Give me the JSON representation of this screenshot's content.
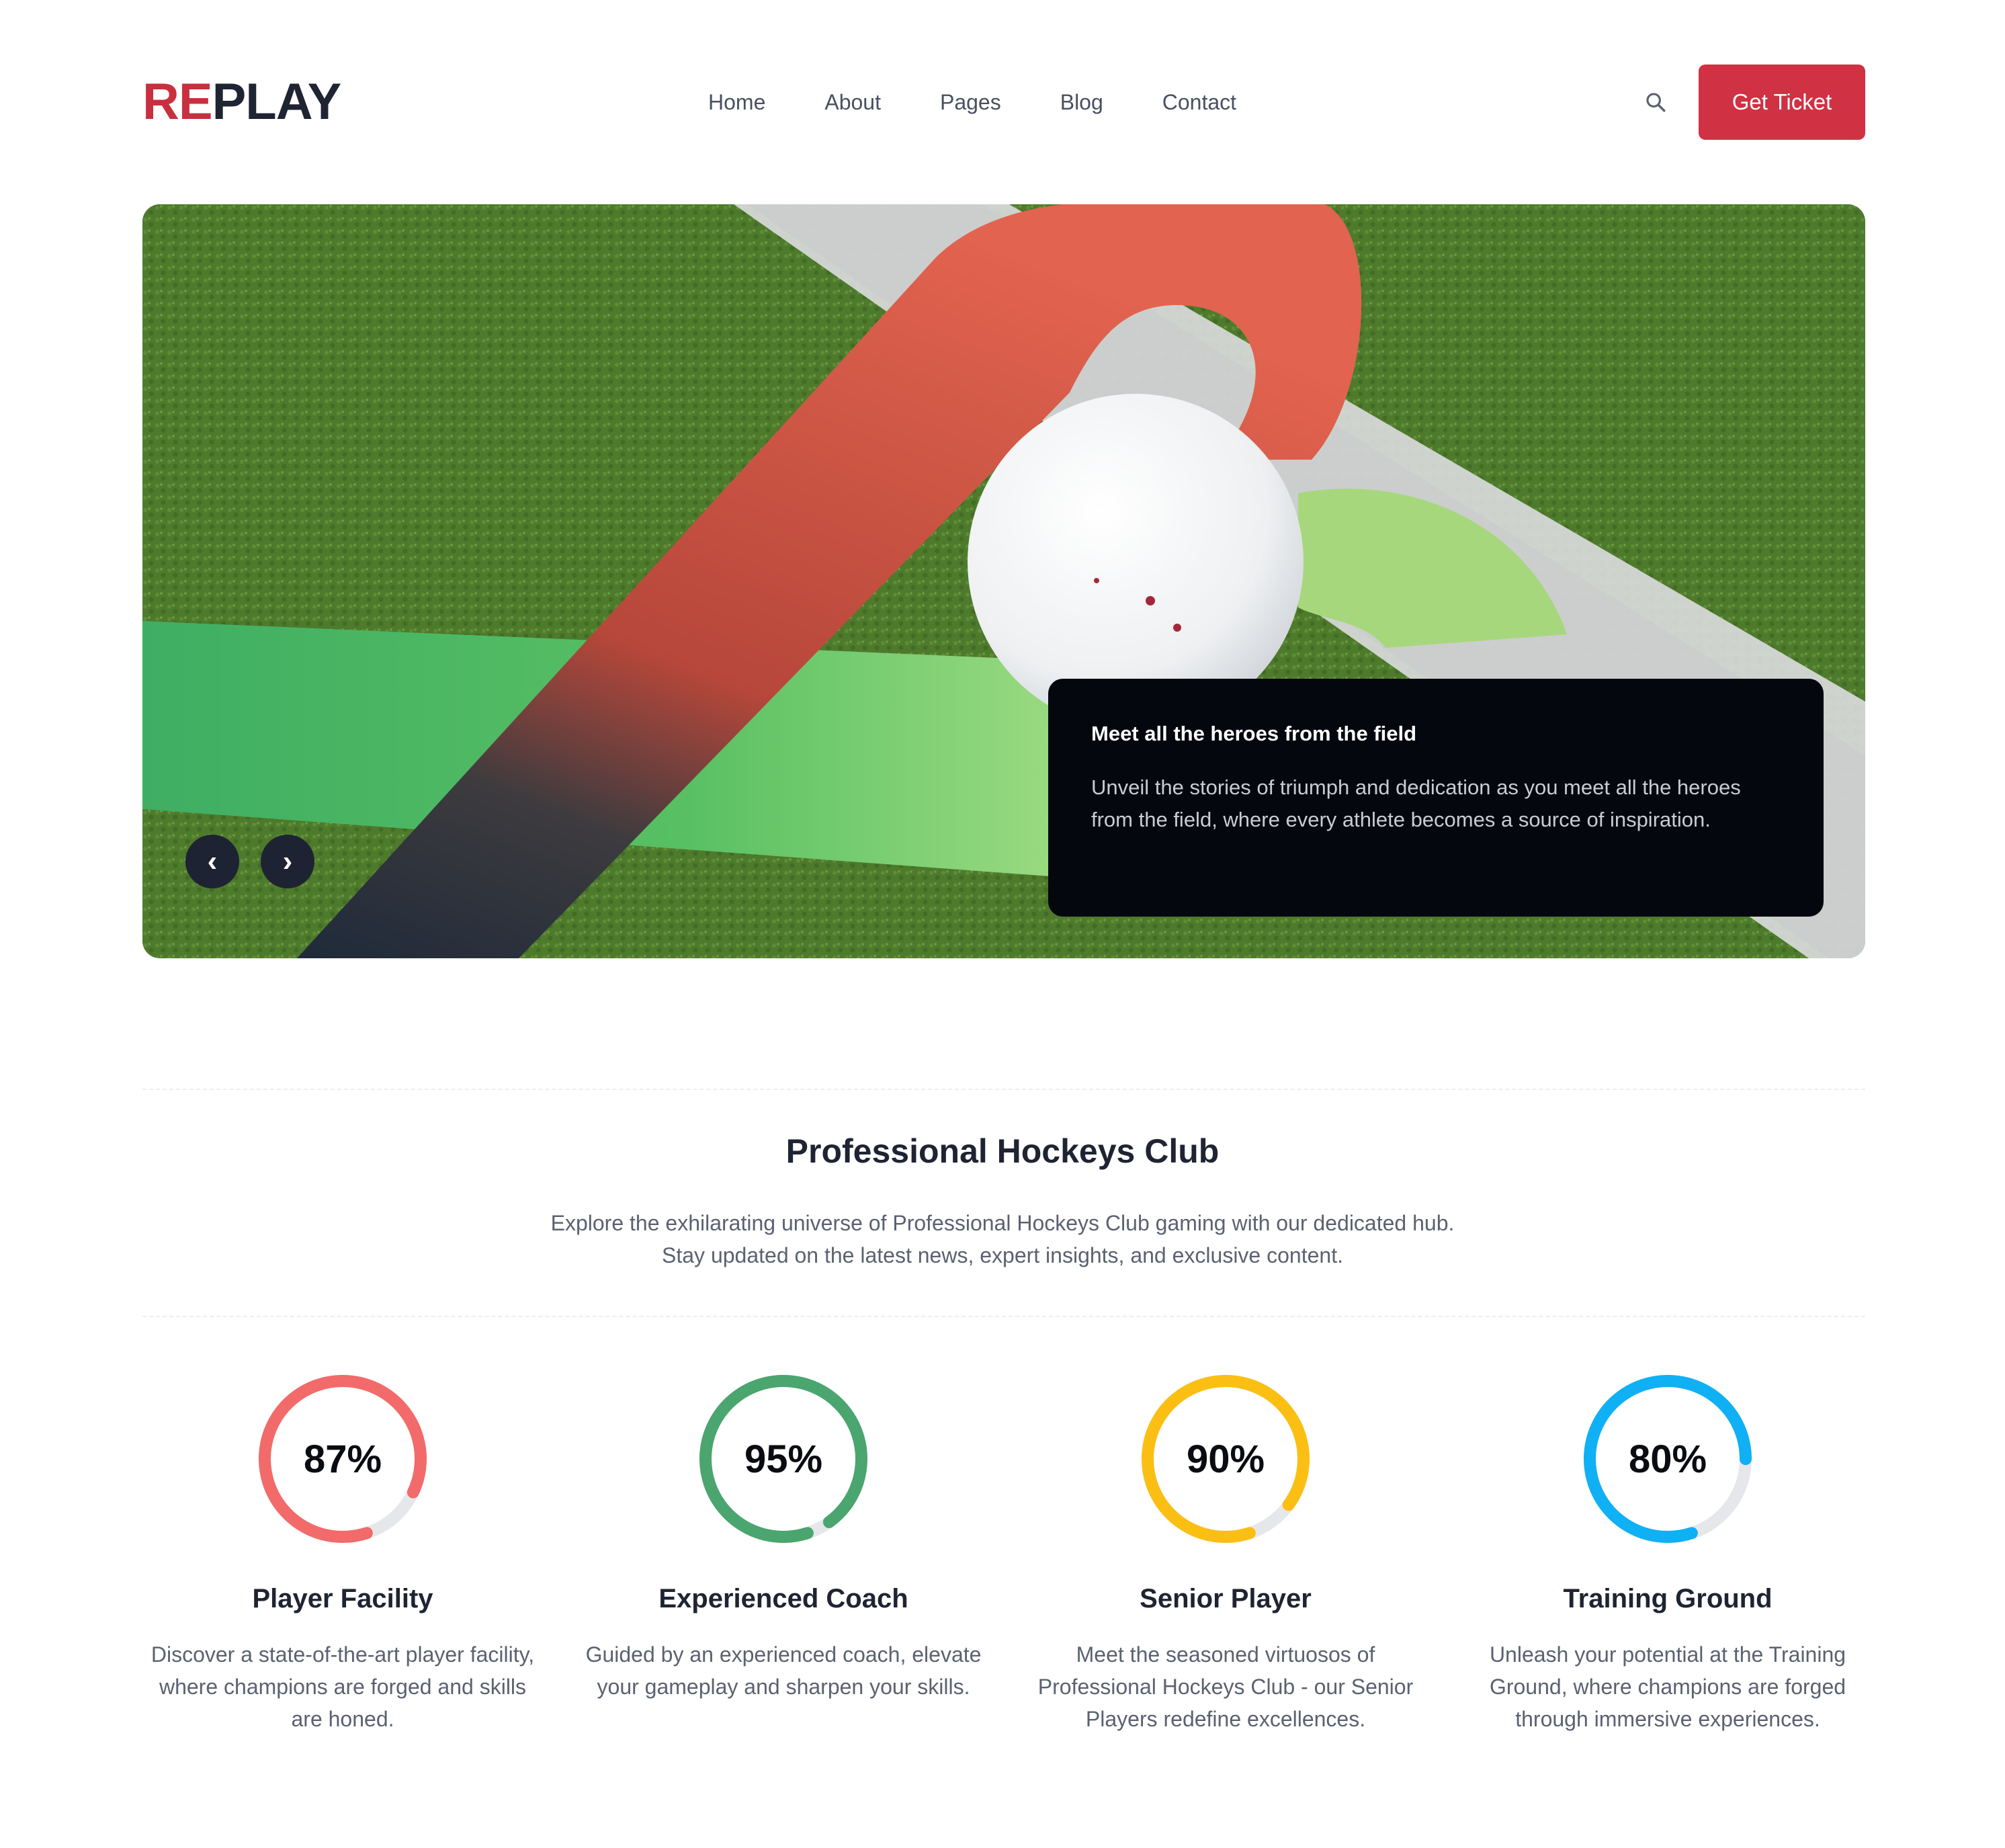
{
  "brand": {
    "logo_part1": "RE",
    "logo_part2": "PLAY",
    "accent": "#c8303f"
  },
  "nav": {
    "items": [
      "Home",
      "About",
      "Pages",
      "Blog",
      "Contact"
    ]
  },
  "header": {
    "search_icon": "search-icon",
    "ticket_label": "Get Ticket"
  },
  "hero": {
    "caption_title": "Meet all the heroes from the field",
    "caption_text": "Unveil the stories of triumph and dedication as you meet all the heroes from the field, where every athlete becomes a source of inspiration.",
    "prev_label": "‹",
    "next_label": "›"
  },
  "intro": {
    "title": "Professional Hockeys Club",
    "description": "Explore the exhilarating universe of Professional Hockeys Club gaming with our dedicated hub. Stay updated on the latest news, expert insights, and exclusive content."
  },
  "stats": [
    {
      "value": 87,
      "label": "87%",
      "title": "Player Facility",
      "text": "Discover a state-of-the-art player facility, where champions are forged and skills are honed.",
      "color": "#f26a6a"
    },
    {
      "value": 95,
      "label": "95%",
      "title": "Experienced Coach",
      "text": "Guided by an experienced coach, elevate your gameplay and sharpen your skills.",
      "color": "#4aa56e"
    },
    {
      "value": 90,
      "label": "90%",
      "title": "Senior Player",
      "text": "Meet the seasoned virtuosos of Professional Hockeys Club - our Senior Players redefine excellences.",
      "color": "#fbbf14"
    },
    {
      "value": 80,
      "label": "80%",
      "title": "Training Ground",
      "text": "Unleash your potential at the Training Ground, where champions are forged through immersive experiences.",
      "color": "#10b0f5"
    }
  ]
}
